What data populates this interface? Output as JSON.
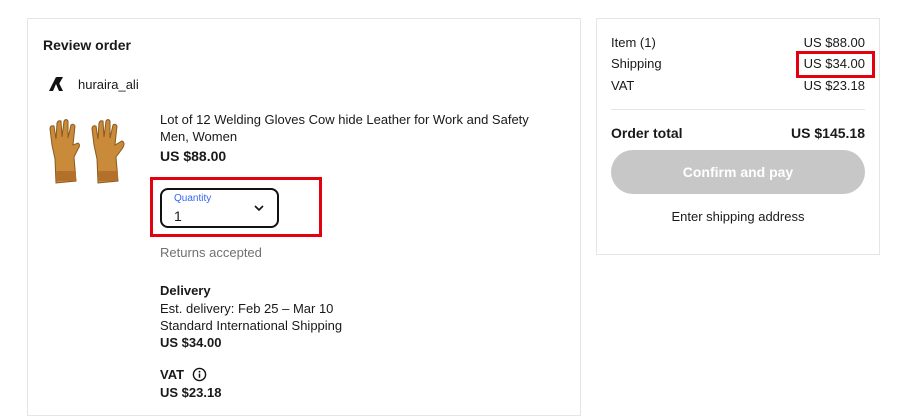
{
  "review": {
    "title": "Review order",
    "seller": "huraira_ali",
    "item": {
      "title": "Lot of 12 Welding Gloves Cow hide Leather for Work and Safety Men, Women",
      "price": "US $88.00",
      "quantity_label": "Quantity",
      "quantity_value": "1",
      "returns": "Returns accepted"
    },
    "delivery": {
      "heading": "Delivery",
      "estimate": "Est. delivery: Feb 25 – Mar 10",
      "method": "Standard International Shipping",
      "cost": "US $34.00"
    },
    "vat": {
      "heading": "VAT",
      "cost": "US $23.18"
    }
  },
  "summary": {
    "rows": [
      {
        "label": "Item (1)",
        "value": "US $88.00"
      },
      {
        "label": "Shipping",
        "value": "US $34.00"
      },
      {
        "label": "VAT",
        "value": "US $23.18"
      }
    ],
    "total_label": "Order total",
    "total_value": "US $145.18",
    "confirm_label": "Confirm and pay",
    "enter_shipping": "Enter shipping address"
  },
  "colors": {
    "highlight": "#e3000f",
    "quantity_label": "#3665f3",
    "disabled_button": "#c7c7c7",
    "glove": "#c98a3a"
  },
  "icons": [
    "seller-logo-icon",
    "chevron-down-icon",
    "info-icon"
  ]
}
